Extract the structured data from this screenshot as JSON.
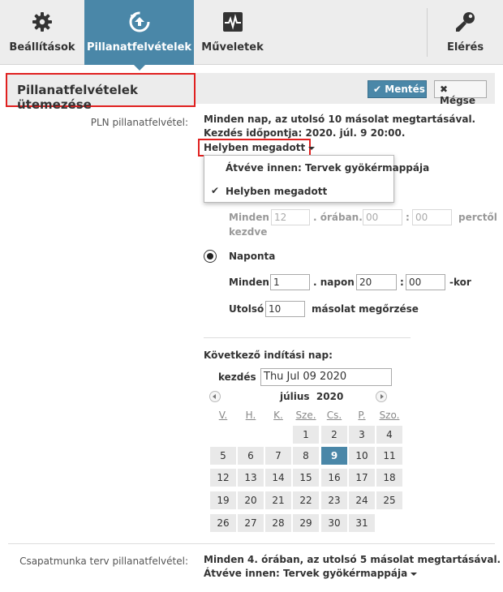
{
  "tabs": [
    {
      "label": "Beállítások",
      "icon": "gear-icon"
    },
    {
      "label": "Pillanatfelvételek",
      "icon": "snapshot-restore-icon"
    },
    {
      "label": "Műveletek",
      "icon": "activity-monitor-icon"
    },
    {
      "label": "Elérés",
      "icon": "key-icon"
    }
  ],
  "header": {
    "title": "Pillanatfelvételek ütemezése",
    "save_label": "Mentés",
    "cancel_label": "Mégse"
  },
  "pln": {
    "label": "PLN pillanatfelvétel:",
    "summary_line1": "Minden nap, az utolsó 10 másolat megtartásával.",
    "summary_line2": "Kezdés időpontja: 2020. júl. 9 20:00.",
    "source_selected": "Helyben megadott",
    "source_options": [
      "Átvéve innen: Tervek gyökérmappája",
      "Helyben megadott"
    ]
  },
  "hourly": {
    "every": "Minden",
    "hour_value": "12",
    "hour_suffix": ". órában.",
    "min1": "00",
    "colon": ":",
    "min2": "00",
    "from_text": "perctől",
    "start_text": "kezdve"
  },
  "daily": {
    "label": "Naponta",
    "every": "Minden",
    "day_value": "1",
    "day_suffix": ". napon",
    "hour": "20",
    "colon": ":",
    "minute": "00",
    "kor": "-kor",
    "keep_label": "Utolsó",
    "keep_value": "10",
    "keep_suffix": "másolat megőrzése"
  },
  "next_run": {
    "label": "Következő indítási nap:",
    "start_label": "kezdés",
    "start_value": "Thu Jul 09 2020"
  },
  "calendar": {
    "month_label": "július  2020",
    "weekdays": [
      "V.",
      "H.",
      "K.",
      "Sze.",
      "Cs.",
      "P.",
      "Szo."
    ],
    "days": [
      "1",
      "2",
      "3",
      "4",
      "5",
      "6",
      "7",
      "8",
      "9",
      "10",
      "11",
      "12",
      "13",
      "14",
      "15",
      "16",
      "17",
      "18",
      "19",
      "20",
      "21",
      "22",
      "23",
      "24",
      "25",
      "26",
      "27",
      "28",
      "29",
      "30",
      "31"
    ],
    "selected": "9",
    "colors": {
      "selected": "#4a87a8",
      "day_bg": "#e9e9e9"
    }
  },
  "team": {
    "label": "Csapatmunka terv pillanatfelvétel:",
    "summary": "Minden 4. órában, az utolsó 5 másolat megtartásával.",
    "source": "Átvéve innen: Tervek gyökérmappája"
  },
  "colors": {
    "accent": "#4a87a8",
    "highlight_box": "#e0201f"
  }
}
